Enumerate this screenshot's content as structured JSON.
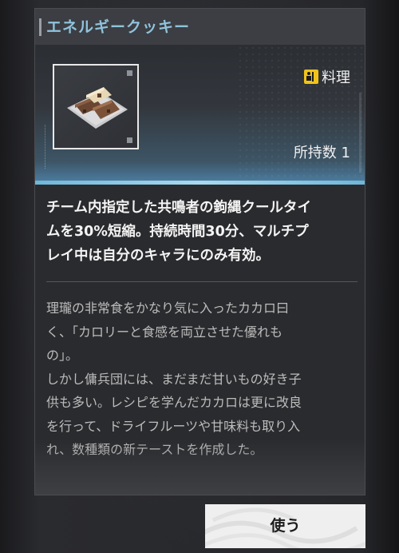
{
  "item": {
    "title": "エネルギークッキー",
    "category_label": "料理",
    "count_label": "所持数 1",
    "effect_text": "チーム内指定した共鳴者の鉤縄クールタイ\nムを30%短縮。持続時間30分、マルチプ\nレイ中は自分のキャラにのみ有効。",
    "lore_text": "理瓏の非常食をかなり気に入ったカカロ曰\nく、「カロリーと食感を両立させた優れも\nの」。\nしかし傭兵団には、まだまだ甘いもの好き子\n供も多い。レシピを学んだカカロは更に改良\nを行って、ドライフルーツや甘味料も取り入\nれ、数種類の新テーストを作成した。"
  },
  "actions": {
    "use_label": "使う"
  },
  "icons": {
    "category": "cooking-icon",
    "item": "energy-cookie-icon"
  },
  "colors": {
    "title": "#8fc3dc",
    "accent_line": "#6fb6d8",
    "category_icon": "#f1c21b",
    "panel_bg": "#2a2b2e"
  }
}
